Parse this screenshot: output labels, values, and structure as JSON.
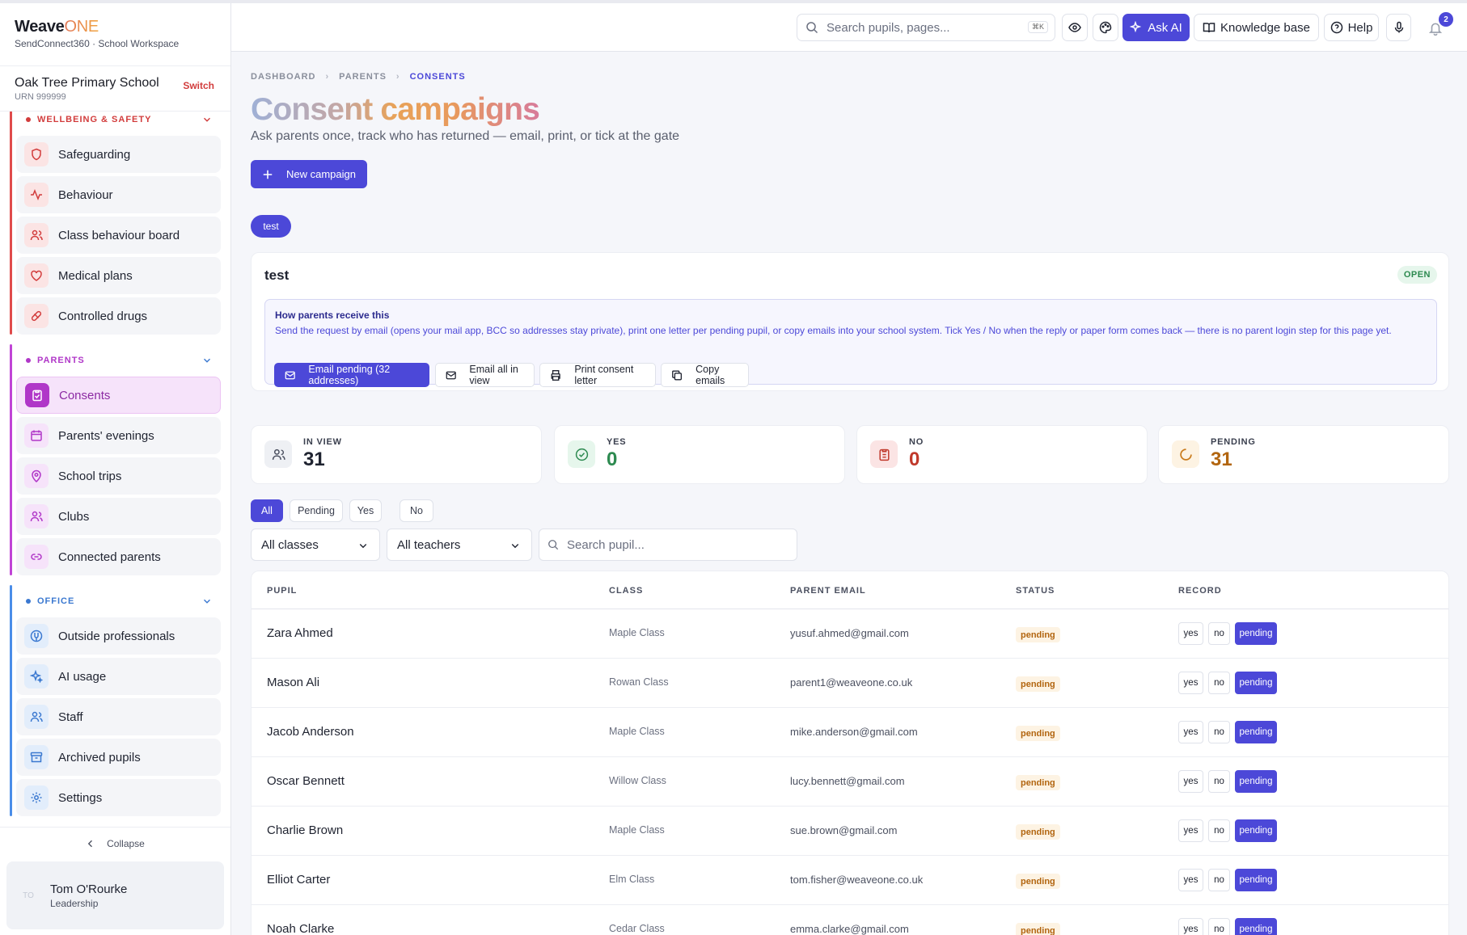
{
  "brand": {
    "name_main": "Weave",
    "name_accent": "ONE",
    "subtitle": "SendConnect360 · School Workspace"
  },
  "school": {
    "name": "Oak Tree Primary School",
    "urn": "URN 999999",
    "switch_label": "Switch"
  },
  "sidebar": {
    "groups": [
      {
        "title": "WELLBEING & SAFETY",
        "color": "#e04b4b",
        "items": [
          "Safeguarding",
          "Behaviour",
          "Class behaviour board",
          "Medical plans",
          "Controlled drugs"
        ]
      },
      {
        "title": "PARENTS",
        "color": "#c044d6",
        "items": [
          "Consents",
          "Parents' evenings",
          "School trips",
          "Clubs",
          "Connected parents"
        ],
        "active": "Consents"
      },
      {
        "title": "OFFICE",
        "color": "#4a8de8",
        "items": [
          "Outside professionals",
          "AI usage",
          "Staff",
          "Archived pupils",
          "Settings"
        ]
      }
    ],
    "collapse_label": "Collapse",
    "user": {
      "initials": "TO",
      "name": "Tom O'Rourke",
      "role": "Leadership"
    }
  },
  "topbar": {
    "search_placeholder": "Search pupils, pages...",
    "shortcut": "⌘K",
    "ask_ai": "Ask AI",
    "knowledge_base": "Knowledge base",
    "help": "Help",
    "notifications": "2"
  },
  "breadcrumb": [
    "DASHBOARD",
    "PARENTS",
    "CONSENTS"
  ],
  "page": {
    "title": "Consent campaigns",
    "subtitle": "Ask parents once, track who has returned — email, print, or tick at the gate",
    "new_campaign": "New campaign",
    "campaign_chip": "test"
  },
  "campaign": {
    "title": "test",
    "status": "OPEN",
    "how_title": "How parents receive this",
    "how_text": "Send the request by email (opens your mail app, BCC so addresses stay private), print one letter per pending pupil, or copy emails into your school system. Tick Yes / No when the reply or paper form comes back — there is no parent login step for this page yet.",
    "actions": [
      "Email pending (32 addresses)",
      "Email all in view",
      "Print consent letter",
      "Copy emails"
    ]
  },
  "stats": [
    {
      "label": "IN VIEW",
      "value": "31",
      "color": "#1f2330"
    },
    {
      "label": "YES",
      "value": "0",
      "color": "#2d8a50"
    },
    {
      "label": "NO",
      "value": "0",
      "color": "#c0392b"
    },
    {
      "label": "PENDING",
      "value": "31",
      "color": "#b2650f"
    }
  ],
  "filters": {
    "tabs": [
      "All",
      "Pending",
      "Yes",
      "No"
    ],
    "active": "All",
    "class_select": "All classes",
    "teacher_select": "All teachers",
    "pupil_search_placeholder": "Search pupil..."
  },
  "table": {
    "columns": [
      "PUPIL",
      "CLASS",
      "PARENT EMAIL",
      "STATUS",
      "RECORD"
    ],
    "record_options": [
      "yes",
      "no",
      "pending"
    ],
    "rows": [
      {
        "pupil": "Zara Ahmed",
        "class": "Maple Class",
        "email": "yusuf.ahmed@gmail.com",
        "status": "pending"
      },
      {
        "pupil": "Mason Ali",
        "class": "Rowan Class",
        "email": "parent1@weaveone.co.uk",
        "status": "pending"
      },
      {
        "pupil": "Jacob Anderson",
        "class": "Maple Class",
        "email": "mike.anderson@gmail.com",
        "status": "pending"
      },
      {
        "pupil": "Oscar Bennett",
        "class": "Willow Class",
        "email": "lucy.bennett@gmail.com",
        "status": "pending"
      },
      {
        "pupil": "Charlie Brown",
        "class": "Maple Class",
        "email": "sue.brown@gmail.com",
        "status": "pending"
      },
      {
        "pupil": "Elliot Carter",
        "class": "Elm Class",
        "email": "tom.fisher@weaveone.co.uk",
        "status": "pending"
      },
      {
        "pupil": "Noah Clarke",
        "class": "Cedar Class",
        "email": "emma.clarke@gmail.com",
        "status": "pending"
      }
    ]
  }
}
